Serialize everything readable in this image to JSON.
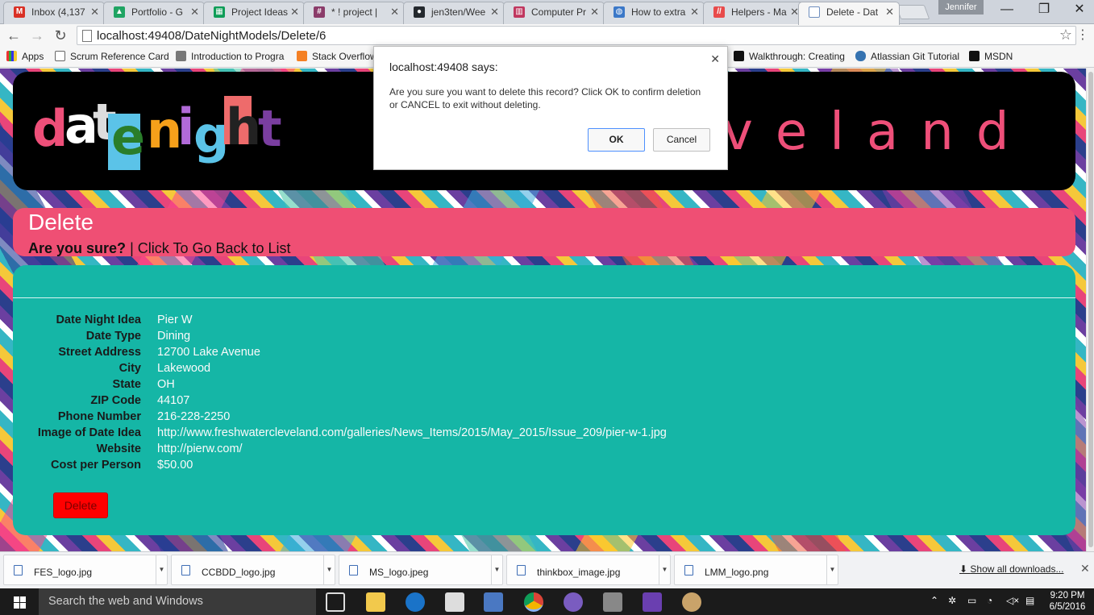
{
  "browser": {
    "tabs": [
      {
        "title": "Inbox (4,137",
        "icon": "gmail-icon",
        "color": "#d93025"
      },
      {
        "title": "Portfolio - G",
        "icon": "google-drive-icon",
        "color": "#1fa463"
      },
      {
        "title": "Project Ideas",
        "icon": "google-sheets-icon",
        "color": "#0f9d58"
      },
      {
        "title": "* ! project |",
        "icon": "slack-icon",
        "color": "#8b3c6a"
      },
      {
        "title": "jen3ten/Wee",
        "icon": "github-icon",
        "color": "#24292e"
      },
      {
        "title": "Computer Pr",
        "icon": "trello-icon",
        "color": "#c0375f"
      },
      {
        "title": "How to extra",
        "icon": "globe-icon",
        "color": "#3b78c8"
      },
      {
        "title": "Helpers - Ma",
        "icon": "hash-icon",
        "color": "#e84b4b"
      },
      {
        "title": "Delete - Dat",
        "icon": "page-icon",
        "color": "#6f8fbf",
        "active": true
      }
    ],
    "profile_name": "Jennifer",
    "url": "localhost:49408/DateNightModels/Delete/6",
    "bookmarks": [
      {
        "label": "Apps",
        "icon": "apps-grid-icon"
      },
      {
        "label": "Scrum Reference Card",
        "icon": "page-icon"
      },
      {
        "label": "Introduction to Progra",
        "icon": "plane-icon"
      },
      {
        "label": "Stack Overflow",
        "icon": "stack-overflow-icon"
      },
      {
        "label": "Walkthrough: Creating",
        "icon": "msdn-icon"
      },
      {
        "label": "Atlassian Git Tutorial",
        "icon": "database-icon"
      },
      {
        "label": "MSDN",
        "icon": "msdn-icon"
      }
    ]
  },
  "site": {
    "logo_text": "date night",
    "banner_city": "veland"
  },
  "page": {
    "heading": "Delete",
    "confirm_question": "Are you sure?",
    "separator": "|",
    "back_link": "Click To Go Back to List",
    "details": [
      {
        "label": "Date Night Idea",
        "value": "Pier W"
      },
      {
        "label": "Date Type",
        "value": "Dining"
      },
      {
        "label": "Street Address",
        "value": "12700 Lake Avenue"
      },
      {
        "label": "City",
        "value": "Lakewood"
      },
      {
        "label": "State",
        "value": "OH"
      },
      {
        "label": "ZIP Code",
        "value": "44107"
      },
      {
        "label": "Phone Number",
        "value": "216-228-2250"
      },
      {
        "label": "Image of Date Idea",
        "value": "http://www.freshwatercleveland.com/galleries/News_Items/2015/May_2015/Issue_209/pier-w-1.jpg"
      },
      {
        "label": "Website",
        "value": "http://pierw.com/"
      },
      {
        "label": "Cost per Person",
        "value": "$50.00"
      }
    ],
    "delete_button": "Delete"
  },
  "dialog": {
    "title": "localhost:49408 says:",
    "message": "Are you sure you want to delete this record? Click OK to confirm deletion or CANCEL to exit without deleting.",
    "ok_label": "OK",
    "cancel_label": "Cancel"
  },
  "downloads": {
    "items": [
      "FES_logo.jpg",
      "CCBDD_logo.jpg",
      "MS_logo.jpeg",
      "thinkbox_image.jpg",
      "LMM_logo.png"
    ],
    "show_all": "Show all downloads..."
  },
  "taskbar": {
    "search_placeholder": "Search the web and Windows",
    "time": "9:20 PM",
    "date": "6/5/2016"
  },
  "colors": {
    "banner_pink": "#ef4f74",
    "teal_panel": "#15b6a6",
    "delete_red": "#ff0000"
  }
}
